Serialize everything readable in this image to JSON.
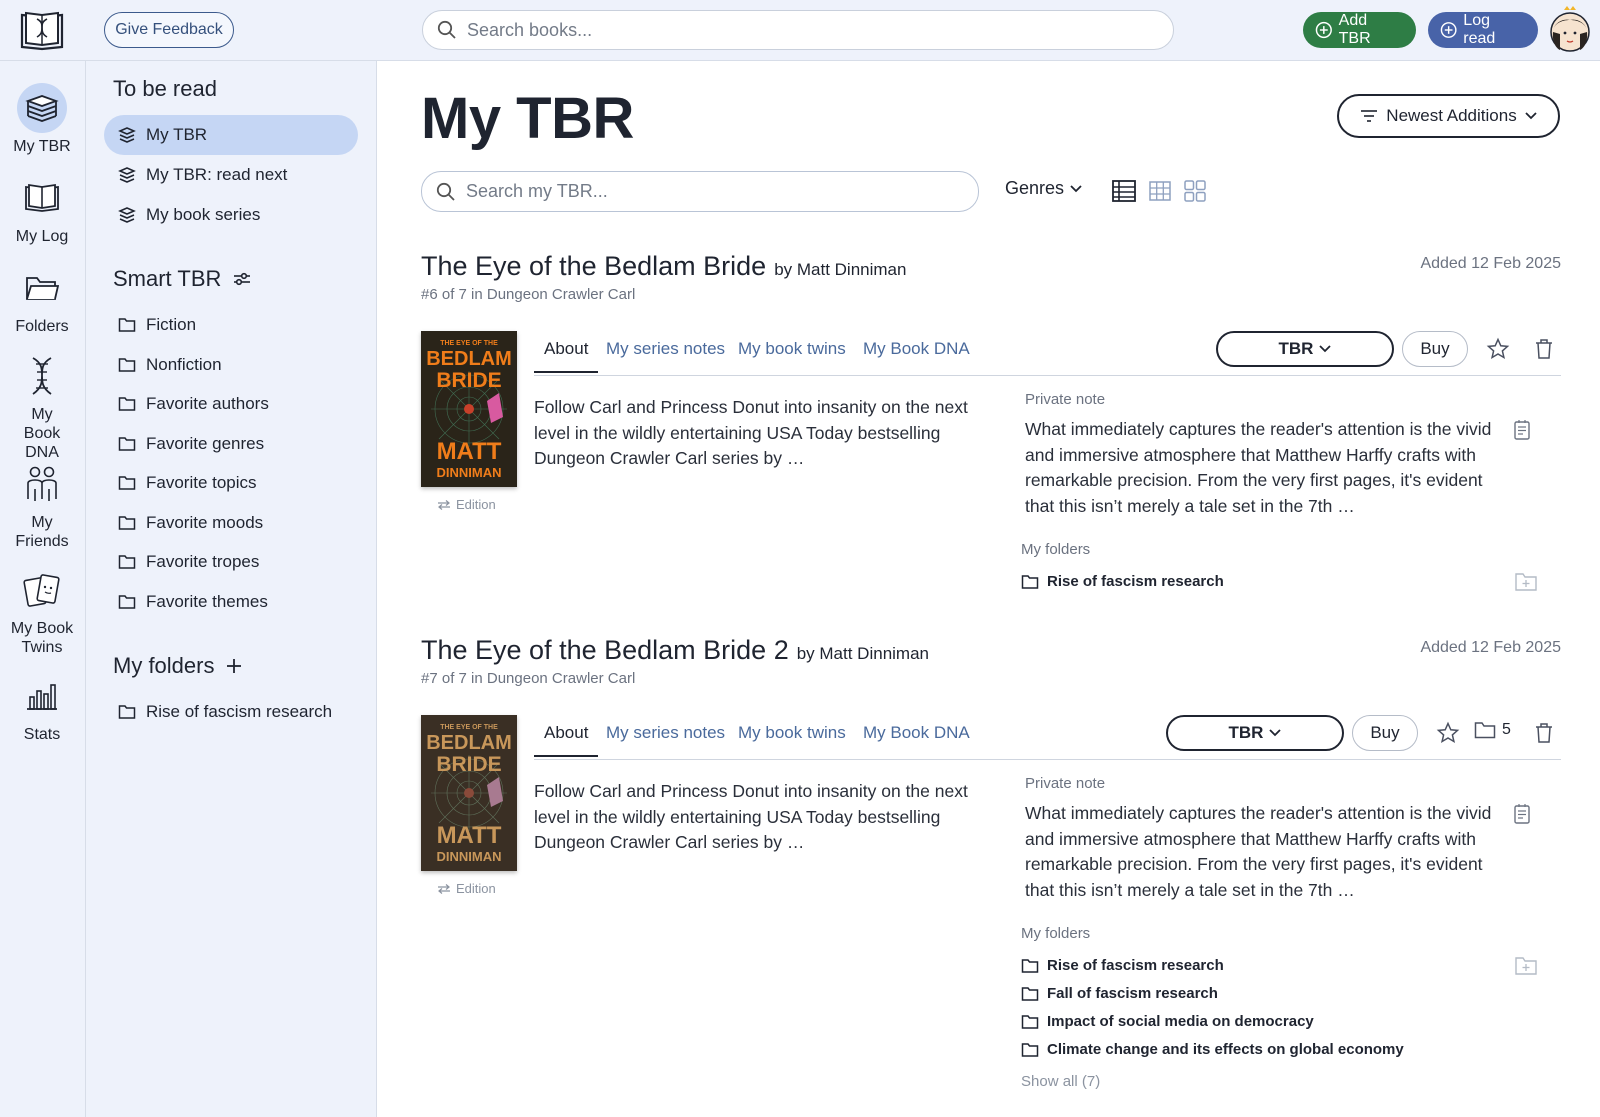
{
  "topbar": {
    "feedback_label": "Give Feedback",
    "search_placeholder": "Search books...",
    "add_tbr_label": "Add TBR",
    "log_read_label": "Log read",
    "colors": {
      "add_tbr": "#2e7d45",
      "log_read": "#4863a8",
      "bar_bg": "#eef2fb"
    }
  },
  "rail": {
    "items": [
      {
        "label": "My TBR",
        "icon": "books-stack-icon",
        "active": true
      },
      {
        "label": "My Log",
        "icon": "open-book-icon"
      },
      {
        "label": "Folders",
        "icon": "folder-icon"
      },
      {
        "label": "My Book DNA",
        "icon": "dna-icon"
      },
      {
        "label": "My Friends",
        "icon": "friends-icon"
      },
      {
        "label": "My Book Twins",
        "icon": "book-twins-icon"
      },
      {
        "label": "Stats",
        "icon": "bar-stats-icon"
      }
    ]
  },
  "nav": {
    "to_be_read_heading": "To be read",
    "tbr_items": [
      "My TBR",
      "My TBR: read next",
      "My book series"
    ],
    "smart_heading": "Smart TBR",
    "smart_items": [
      "Fiction",
      "Nonfiction",
      "Favorite authors",
      "Favorite genres",
      "Favorite topics",
      "Favorite moods",
      "Favorite tropes",
      "Favorite themes"
    ],
    "folders_heading": "My folders",
    "folder_items": [
      "Rise of fascism research"
    ]
  },
  "main": {
    "title": "My TBR",
    "sort_label": "Newest Additions",
    "search_placeholder": "Search my TBR...",
    "genres_label": "Genres"
  },
  "books": [
    {
      "title": "The Eye of the Bedlam Bride",
      "author": "by Matt Dinniman",
      "series": "#6 of 7 in Dungeon Crawler Carl",
      "added": "Added 12 Feb 2025",
      "cover_lines": [
        "THE EYE OF THE",
        "BEDLAM",
        "BRIDE",
        "MATT",
        "DINNIMAN"
      ],
      "edition_label": "Edition",
      "tabs": [
        "About",
        "My series notes",
        "My book twins",
        "My Book DNA"
      ],
      "status": "TBR",
      "buy_label": "Buy",
      "about": "Follow Carl and Princess Donut into insanity on the next level in the wildly entertaining USA Today bestselling Dungeon Crawler Carl series by …",
      "note_label": "Private note",
      "note": "What immediately captures the reader's attention is the vivid and immersive atmosphere that Matthew Harffy crafts with remarkable precision. From the very first pages, it's evident that this isn’t merely a tale set in the 7th …",
      "folders_label": "My folders",
      "folders": [
        "Rise of fascism research"
      ]
    },
    {
      "title": "The Eye of the Bedlam Bride 2",
      "author": "by Matt Dinniman",
      "series": "#7 of 7 in Dungeon Crawler Carl",
      "added": "Added 12 Feb 2025",
      "cover_lines": [
        "THE EYE OF THE",
        "BEDLAM",
        "BRIDE",
        "MATT",
        "DINNIMAN"
      ],
      "edition_label": "Edition",
      "tabs": [
        "About",
        "My series notes",
        "My book twins",
        "My Book DNA"
      ],
      "status": "TBR",
      "buy_label": "Buy",
      "folder_count": "5",
      "about": "Follow Carl and Princess Donut into insanity on the next level in the wildly entertaining USA Today bestselling Dungeon Crawler Carl series by …",
      "note_label": "Private note",
      "note": "What immediately captures the reader's attention is the vivid and immersive atmosphere that Matthew Harffy crafts with remarkable precision. From the very first pages, it's evident that this isn’t merely a tale set in the 7th …",
      "folders_label": "My folders",
      "folders": [
        "Rise of fascism research",
        "Fall of fascism research",
        "Impact of social media on democracy",
        "Climate change and its effects on global economy"
      ],
      "show_all": "Show all (7)"
    }
  ]
}
